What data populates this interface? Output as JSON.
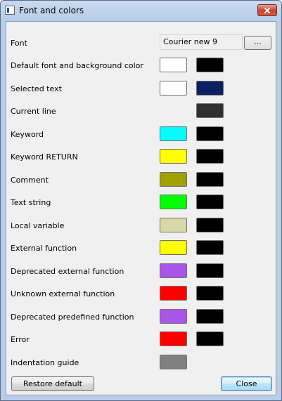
{
  "window": {
    "title": "Font and colors"
  },
  "font": {
    "label": "Font",
    "value": "Courier new 9",
    "browse_label": "..."
  },
  "rows": [
    {
      "label": "Default font and background color",
      "fg": "#ffffff",
      "bg": "#000000"
    },
    {
      "label": "Selected text",
      "fg": "#ffffff",
      "bg": "#0a2060"
    },
    {
      "label": "Current line",
      "fg": null,
      "bg": "#303030"
    },
    {
      "label": "Keyword",
      "fg": "#00ffff",
      "bg": "#000000"
    },
    {
      "label": "Keyword RETURN",
      "fg": "#ffff00",
      "bg": "#000000"
    },
    {
      "label": "Comment",
      "fg": "#a0a000",
      "bg": "#000000"
    },
    {
      "label": "Text string",
      "fg": "#00ff00",
      "bg": "#000000"
    },
    {
      "label": "Local variable",
      "fg": "#d8d8a8",
      "bg": "#000000"
    },
    {
      "label": "External function",
      "fg": "#ffff00",
      "bg": "#000000"
    },
    {
      "label": "Deprecated external function",
      "fg": "#a855e8",
      "bg": "#000000"
    },
    {
      "label": "Unknown external function",
      "fg": "#ff0000",
      "bg": "#000000"
    },
    {
      "label": "Deprecated predefined function",
      "fg": "#a855e8",
      "bg": "#000000"
    },
    {
      "label": "Error",
      "fg": "#ff0000",
      "bg": "#000000"
    },
    {
      "label": "Indentation guide",
      "fg": "#808080",
      "bg": null
    }
  ],
  "buttons": {
    "restore": "Restore default",
    "close": "Close"
  }
}
